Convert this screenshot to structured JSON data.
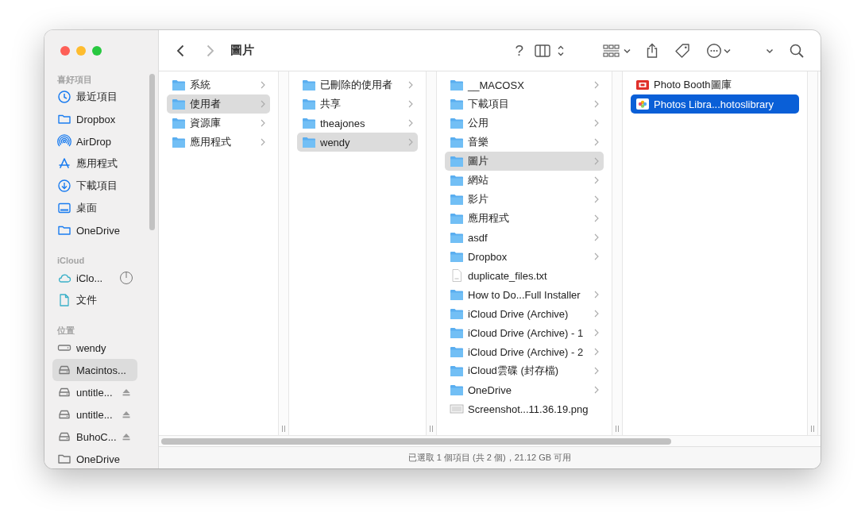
{
  "window": {
    "title": "圖片"
  },
  "toolbar": {
    "help": "?",
    "back_disabled": false,
    "forward_disabled": true
  },
  "sidebar": {
    "sections": [
      {
        "heading": "喜好項目",
        "items": [
          {
            "label": "最近項目",
            "kind": "recents",
            "selected": false
          },
          {
            "label": "Dropbox",
            "kind": "folder",
            "selected": false
          },
          {
            "label": "AirDrop",
            "kind": "airdrop",
            "selected": false
          },
          {
            "label": "應用程式",
            "kind": "apps",
            "selected": false
          },
          {
            "label": "下載項目",
            "kind": "downloads",
            "selected": false
          },
          {
            "label": "桌面",
            "kind": "desktop",
            "selected": false
          },
          {
            "label": "OneDrive",
            "kind": "folder",
            "selected": false
          }
        ]
      },
      {
        "heading": "iCloud",
        "items": [
          {
            "label": "iClo...",
            "kind": "icloud-syncing",
            "selected": false
          },
          {
            "label": "文件",
            "kind": "documents",
            "selected": false
          }
        ]
      },
      {
        "heading": "位置",
        "items": [
          {
            "label": "wendy",
            "kind": "computer",
            "selected": false
          },
          {
            "label": "Macintos...",
            "kind": "disk",
            "selected": true
          },
          {
            "label": "untitle...",
            "kind": "removable-disk",
            "selected": false
          },
          {
            "label": "untitle...",
            "kind": "removable-disk",
            "selected": false
          },
          {
            "label": "BuhoC...",
            "kind": "removable-disk",
            "selected": false
          },
          {
            "label": "OneDrive",
            "kind": "location-folder",
            "selected": false
          }
        ]
      }
    ]
  },
  "columns": [
    {
      "focused": false,
      "items": [
        {
          "label": "系統",
          "kind": "folder",
          "selected": false
        },
        {
          "label": "使用者",
          "kind": "folder",
          "selected": true
        },
        {
          "label": "資源庫",
          "kind": "folder",
          "selected": false
        },
        {
          "label": "應用程式",
          "kind": "folder",
          "selected": false
        }
      ]
    },
    {
      "focused": false,
      "items": [
        {
          "label": "已刪除的使用者",
          "kind": "folder",
          "selected": false
        },
        {
          "label": "共享",
          "kind": "folder",
          "selected": false
        },
        {
          "label": "theajones",
          "kind": "folder",
          "selected": false
        },
        {
          "label": "wendy",
          "kind": "folder",
          "selected": true
        }
      ]
    },
    {
      "focused": false,
      "items": [
        {
          "label": "__MACOSX",
          "kind": "folder",
          "selected": false
        },
        {
          "label": "下載項目",
          "kind": "folder",
          "selected": false
        },
        {
          "label": "公用",
          "kind": "folder",
          "selected": false
        },
        {
          "label": "音樂",
          "kind": "folder",
          "selected": false
        },
        {
          "label": "圖片",
          "kind": "folder",
          "selected": true
        },
        {
          "label": "網站",
          "kind": "folder",
          "selected": false
        },
        {
          "label": "影片",
          "kind": "folder",
          "selected": false
        },
        {
          "label": "應用程式",
          "kind": "folder",
          "selected": false
        },
        {
          "label": "asdf",
          "kind": "folder",
          "selected": false
        },
        {
          "label": "Dropbox",
          "kind": "folder",
          "selected": false
        },
        {
          "label": "duplicate_files.txt",
          "kind": "text-file",
          "selected": false
        },
        {
          "label": "How to Do...Full Installer",
          "kind": "folder",
          "selected": false
        },
        {
          "label": "iCloud Drive (Archive)",
          "kind": "folder",
          "selected": false
        },
        {
          "label": "iCloud Drive (Archive) - 1",
          "kind": "folder",
          "selected": false
        },
        {
          "label": "iCloud Drive (Archive) - 2",
          "kind": "folder",
          "selected": false
        },
        {
          "label": "iCloud雲碟 (封存檔)",
          "kind": "folder",
          "selected": false
        },
        {
          "label": "OneDrive",
          "kind": "folder",
          "selected": false
        },
        {
          "label": "Screenshot...11.36.19.png",
          "kind": "image-file",
          "selected": false
        }
      ]
    },
    {
      "focused": true,
      "items": [
        {
          "label": "Photo Booth圖庫",
          "kind": "photobooth-library",
          "selected": false
        },
        {
          "label": "Photos Libra...hotoslibrary",
          "kind": "photos-library",
          "selected": true
        }
      ]
    }
  ],
  "status_bar": {
    "text": "已選取 1 個項目 (共 2 個)，21.12 GB 可用"
  }
}
